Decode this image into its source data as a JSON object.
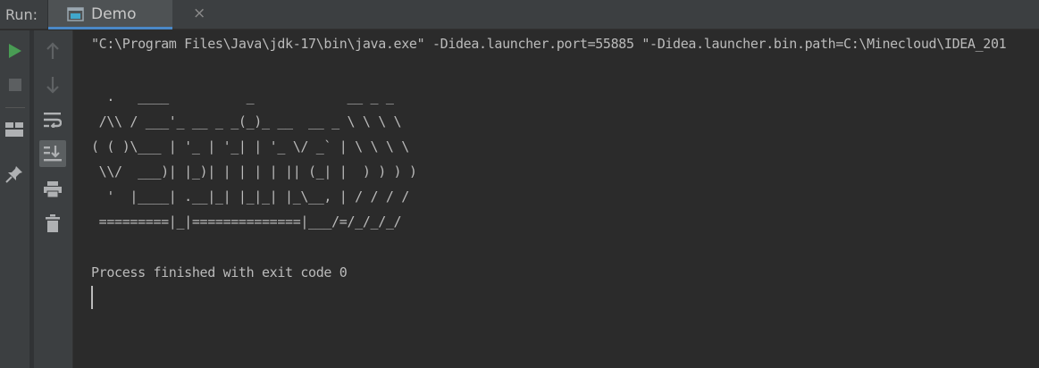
{
  "run_panel": {
    "label": "Run:",
    "tab": {
      "title": "Demo",
      "close_glyph": "×",
      "icon": "console-window-icon"
    }
  },
  "left_toolbar": {
    "buttons": [
      {
        "name": "rerun-button",
        "icon": "play-icon",
        "color": "#499c54"
      },
      {
        "name": "stop-button",
        "icon": "stop-icon"
      },
      {
        "name": "layout-button",
        "icon": "layout-icon"
      },
      {
        "name": "pin-tab-button",
        "icon": "pin-icon"
      }
    ]
  },
  "console_toolbar": {
    "buttons": [
      {
        "name": "scroll-up-button",
        "icon": "arrow-up-icon"
      },
      {
        "name": "scroll-down-button",
        "icon": "arrow-down-icon"
      },
      {
        "name": "soft-wrap-button",
        "icon": "soft-wrap-icon"
      },
      {
        "name": "scroll-to-end-button",
        "icon": "scroll-to-end-icon",
        "active": true
      },
      {
        "name": "print-button",
        "icon": "print-icon"
      },
      {
        "name": "clear-all-button",
        "icon": "trash-icon"
      }
    ]
  },
  "console": {
    "command_line": "\"C:\\Program Files\\Java\\jdk-17\\bin\\java.exe\" -Didea.launcher.port=55885 \"-Didea.launcher.bin.path=C:\\Minecloud\\IDEA_201",
    "banner": "  .   ____          _            __ _ _\n /\\\\ / ___'_ __ _ _(_)_ __  __ _ \\ \\ \\ \\\n( ( )\\___ | '_ | '_| | '_ \\/ _` | \\ \\ \\ \\\n \\\\/  ___)| |_)| | | | | || (_| |  ) ) ) )\n  '  |____| .__|_| |_|_| |_\\__, | / / / /\n =========|_|==============|___/=/_/_/_/",
    "exit_message": "Process finished with exit code 0"
  },
  "colors": {
    "background": "#2b2b2b",
    "panel": "#3c3f41",
    "tab_active": "#4e5254",
    "accent": "#4a88c7",
    "text": "#bbbbbb",
    "run_green": "#499c54"
  }
}
